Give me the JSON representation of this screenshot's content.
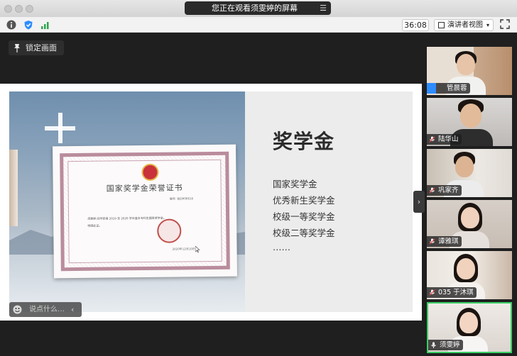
{
  "window": {
    "share_banner": "您正在观看须雯婷的屏幕",
    "menu_glyph": "☰"
  },
  "toolbar": {
    "timer": "36:08",
    "view_button_label": "演讲者视图",
    "view_arrow": "▾"
  },
  "lock_button": {
    "label": "锁定画面"
  },
  "slide": {
    "title": "奖学金",
    "items": [
      "国家奖学金",
      "优秀新生奖学金",
      "校级一等奖学金",
      "校级二等奖学金",
      "……"
    ],
    "certificate": {
      "title": "国家奖学金荣誉证书",
      "number": "编号: BJEM06616",
      "body_line": "须雯婷  同学获得  2019  至  2020  学年度本专科生国家奖学金。",
      "body_line2": "特颁此证。",
      "date": "2020年12月10日"
    }
  },
  "chat_input": {
    "placeholder": "说点什么…",
    "collapse_glyph": "‹"
  },
  "sidebar_toggle": "›",
  "participants": [
    {
      "name": "管晨蓉",
      "role": "host"
    },
    {
      "name": "陆华山",
      "role": "participant"
    },
    {
      "name": "巩家齐",
      "role": "participant"
    },
    {
      "name": "谭雅琪",
      "role": "participant"
    },
    {
      "name": "035 于沐琪",
      "role": "participant"
    },
    {
      "name": "须雯婷",
      "role": "active-speaker"
    }
  ],
  "colors": {
    "active_speaker_border": "#3ccf65",
    "host_badge": "#2d8cff",
    "toolbar_bg": "#f2f2f2",
    "app_bg": "#1f1f1f"
  }
}
